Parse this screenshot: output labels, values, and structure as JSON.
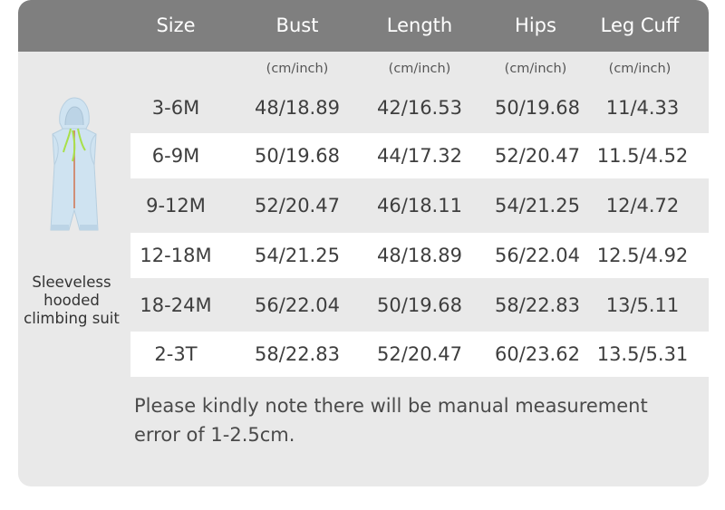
{
  "headers": [
    "Size",
    "Bust",
    "Length",
    "Hips",
    "Leg Cuff"
  ],
  "units": [
    "(cm/inch)",
    "(cm/inch)",
    "(cm/inch)",
    "(cm/inch)"
  ],
  "rows": [
    [
      "3-6M",
      "48/18.89",
      "42/16.53",
      "50/19.68",
      "11/4.33"
    ],
    [
      "6-9M",
      "50/19.68",
      "44/17.32",
      "52/20.47",
      "11.5/4.52"
    ],
    [
      "9-12M",
      "52/20.47",
      "46/18.11",
      "54/21.25",
      "12/4.72"
    ],
    [
      "12-18M",
      "54/21.25",
      "48/18.89",
      "56/22.04",
      "12.5/4.92"
    ],
    [
      "18-24M",
      "56/22.04",
      "50/19.68",
      "58/22.83",
      "13/5.11"
    ],
    [
      "2-3T",
      "58/22.83",
      "52/20.47",
      "60/23.62",
      "13.5/5.31"
    ]
  ],
  "product": {
    "name_lines": [
      "Sleeveless",
      "hooded",
      "climbing suit"
    ],
    "garment_color": "#cfe3f1",
    "accent_color": "#a8e04a"
  },
  "note": "Please kindly note there will be manual measurement error of 1-2.5cm.",
  "colors": {
    "header_bg": "#7f7f7f",
    "card_bg": "#e9e9e9",
    "row_highlight": "#ffffff"
  }
}
